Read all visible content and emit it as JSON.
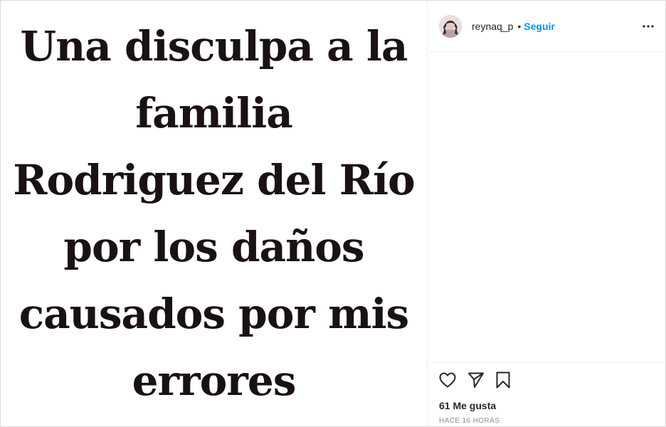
{
  "post": {
    "image_caption_lines": [
      "Una disculpa a la",
      "familia",
      "Rodriguez del Río",
      "por los daños",
      "causados por mis",
      "errores"
    ]
  },
  "header": {
    "username": "reynaq_p",
    "separator": "•",
    "follow_label": "Seguir",
    "more_label": "..."
  },
  "footer": {
    "likes_text": "61 Me gusta",
    "timestamp": "HACE 16 HORAS"
  },
  "icons": {
    "like": "heart-icon",
    "share": "paper-plane-icon",
    "save": "bookmark-icon",
    "options": "ellipsis-icon"
  },
  "colors": {
    "accent": "#0095f6",
    "text": "#262626",
    "muted": "#8e8e8e",
    "media_text": "#1a1212"
  }
}
